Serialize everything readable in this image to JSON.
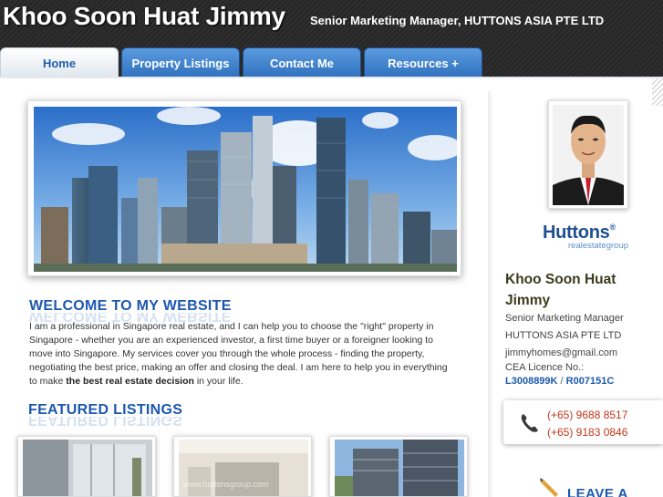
{
  "header": {
    "title": "Khoo Soon Huat Jimmy",
    "subtitle": "Senior Marketing Manager, HUTTONS ASIA PTE LTD"
  },
  "nav": {
    "tabs": [
      {
        "label": "Home",
        "active": true
      },
      {
        "label": "Property Listings",
        "active": false
      },
      {
        "label": "Contact Me",
        "active": false
      },
      {
        "label": "Resources +",
        "active": false
      }
    ]
  },
  "welcome": {
    "heading": "WELCOME TO MY WEBSITE",
    "paragraph_start": "I am a professional in Singapore real estate, and I can help you to choose the \"right\" property in Singapore - whether you are an experienced investor, a first time buyer or a foreigner looking to move into Singapore. My services cover you through the whole process - finding the property, negotiating the best price, making an offer and closing the deal. I am here to help you in everything to make ",
    "paragraph_bold": "the best real estate decision",
    "paragraph_end": " in your life."
  },
  "featured": {
    "heading": "FEATURED LISTINGS",
    "watermark": "www.huttonsgroup.com"
  },
  "sidebar": {
    "logo_main": "Huttons",
    "logo_reg": "®",
    "logo_sub": "realestategroup",
    "name": "Khoo Soon Huat Jimmy",
    "position": "Senior Marketing Manager",
    "company": "HUTTONS ASIA PTE LTD",
    "email": "jimmyhomes@gmail.com",
    "cea_label": "CEA Licence No.:",
    "cea_agency": "L3008899K",
    "cea_separator": " / ",
    "cea_agent": "R007151C",
    "phones": [
      "(+65) 9688 8517",
      "(+65) 9183 0846"
    ],
    "leave_label": "LEAVE A"
  },
  "colors": {
    "header_bg": "#2b2b2b",
    "tab_blue": "#3f82d0",
    "heading_blue": "#1d58b0",
    "phone_red": "#c2361b",
    "name_color": "#3b3b1e"
  }
}
